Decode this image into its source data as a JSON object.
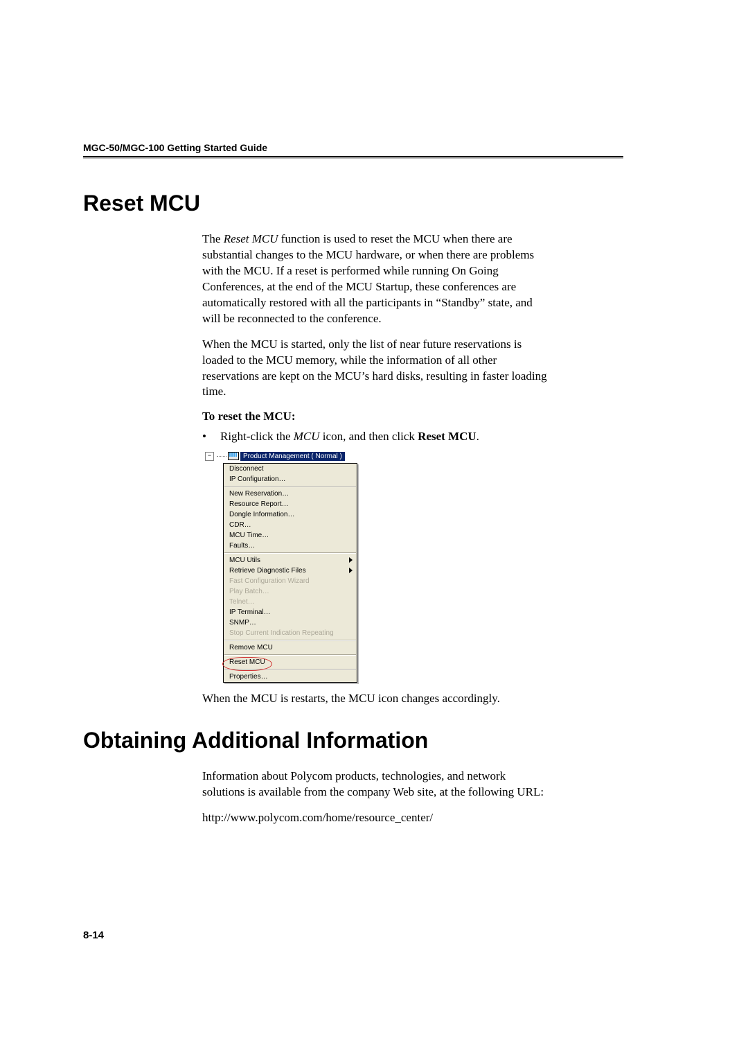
{
  "header": {
    "running": "MGC-50/MGC-100 Getting Started Guide"
  },
  "section1": {
    "title": "Reset MCU",
    "p1a": "The ",
    "p1b": "Reset MCU",
    "p1c": " function is used to reset the MCU when there are substantial changes to the MCU hardware, or when there are problems with the MCU. If a reset is performed while running On Going Conferences, at the end of the MCU Startup, these conferences are automatically restored with all the participants in “Standby” state, and will be reconnected to the conference.",
    "p2": "When the MCU is started, only the list of near future reservations is loaded to the MCU memory, while the information of all other reservations are kept on the MCU’s hard disks, resulting in faster loading time.",
    "sub": "To reset the MCU:",
    "bullet_a": "Right-click the ",
    "bullet_b": "MCU",
    "bullet_c": " icon, and then click ",
    "bullet_d": "Reset MCU",
    "bullet_e": ".",
    "node_label": "Product Management   ( Normal )",
    "menu_group1": [
      "Disconnect",
      "IP Configuration…"
    ],
    "menu_group2": [
      "New Reservation…",
      "Resource Report…",
      "Dongle Information…",
      "CDR…",
      "MCU Time…",
      "Faults…"
    ],
    "menu_group3a": "MCU Utils",
    "menu_group3b": "Retrieve Diagnostic Files",
    "menu_group3_disabled": [
      "Fast Configuration Wizard",
      "Play Batch…",
      "Telnet…"
    ],
    "menu_group3c": [
      "IP Terminal…",
      "SNMP…"
    ],
    "menu_group3d": "Stop Current Indication Repeating",
    "menu_group4": "Remove MCU",
    "menu_group5": "Reset MCU",
    "menu_group6": "Properties…",
    "caption": "When the MCU is restarts, the MCU icon changes accordingly."
  },
  "section2": {
    "title": "Obtaining Additional Information",
    "p1": "Information about Polycom products, technologies, and network solutions is available from the company Web site, at the following URL:",
    "p2": "http://www.polycom.com/home/resource_center/"
  },
  "page_number": "8-14"
}
